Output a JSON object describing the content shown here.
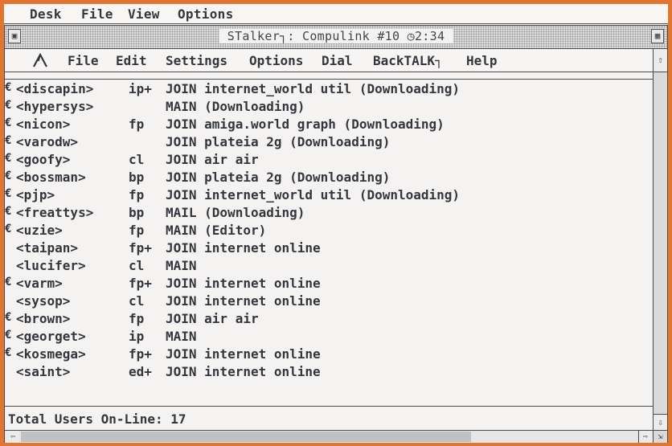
{
  "desk_menu": [
    "Desk",
    "File",
    "View",
    "Options"
  ],
  "window": {
    "title": "STalker┐: Compulink #10  ◷2:34"
  },
  "app_menu": [
    "File",
    "Edit",
    "Settings",
    "Options",
    "Dial",
    "BackTALK┐",
    "Help"
  ],
  "icons": {
    "logo": "stalker-logo-icon",
    "closer": "window-close-icon",
    "fuller": "window-full-icon",
    "scroll_up": "arrow-up-icon",
    "scroll_down": "arrow-down-icon",
    "scroll_left": "arrow-left-icon",
    "scroll_right": "arrow-right-icon",
    "sizer": "window-size-icon"
  },
  "users": [
    {
      "marker": "€",
      "nick": "<discapin>",
      "flags": "ip+",
      "action": "JOIN internet_world util (Downloading)"
    },
    {
      "marker": "€",
      "nick": "<hypersys>",
      "flags": "",
      "action": "MAIN (Downloading)"
    },
    {
      "marker": "€",
      "nick": "<nicon>",
      "flags": "fp",
      "action": "JOIN amiga.world graph (Downloading)"
    },
    {
      "marker": "€",
      "nick": "<varodw>",
      "flags": "",
      "action": "JOIN plateia 2g (Downloading)"
    },
    {
      "marker": "€",
      "nick": "<goofy>",
      "flags": "cl",
      "action": "JOIN air air"
    },
    {
      "marker": "€",
      "nick": "<bossman>",
      "flags": "bp",
      "action": "JOIN plateia 2g (Downloading)"
    },
    {
      "marker": "€",
      "nick": "<pjp>",
      "flags": "fp",
      "action": "JOIN internet_world util (Downloading)"
    },
    {
      "marker": "€",
      "nick": "<freattys>",
      "flags": "bp",
      "action": "MAIL (Downloading)"
    },
    {
      "marker": "€",
      "nick": "<uzie>",
      "flags": "fp",
      "action": "MAIN (Editor)"
    },
    {
      "marker": "",
      "nick": "<taipan>",
      "flags": "fp+",
      "action": "JOIN internet online"
    },
    {
      "marker": "",
      "nick": "<lucifer>",
      "flags": "cl",
      "action": "MAIN"
    },
    {
      "marker": "€",
      "nick": "<varm>",
      "flags": "fp+",
      "action": "JOIN internet online"
    },
    {
      "marker": "",
      "nick": "<sysop>",
      "flags": "cl",
      "action": "JOIN internet online"
    },
    {
      "marker": "€",
      "nick": "<brown>",
      "flags": "fp",
      "action": "JOIN air air"
    },
    {
      "marker": "€",
      "nick": "<georget>",
      "flags": "ip",
      "action": "MAIN"
    },
    {
      "marker": "€",
      "nick": "<kosmega>",
      "flags": "fp+",
      "action": "JOIN internet online"
    },
    {
      "marker": "",
      "nick": "<saint>",
      "flags": "ed+",
      "action": "JOIN internet online"
    }
  ],
  "status": "Total Users On-Line: 17"
}
